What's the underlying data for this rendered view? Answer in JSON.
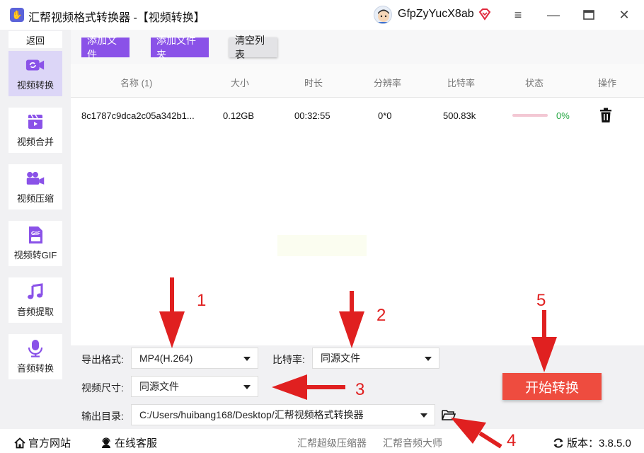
{
  "window": {
    "title": "汇帮视频格式转换器  -【视频转换】",
    "username": "GfpZyYucX8ab",
    "icons": {
      "app": "app-logo-icon",
      "avatar": "user-avatar",
      "vip": "vip-diamond-icon",
      "menu": "menu-icon",
      "minimize": "minimize-icon",
      "maximize": "maximize-icon",
      "close": "close-icon"
    }
  },
  "sidebar": {
    "back_label": "返回",
    "items": [
      {
        "label": "视频转换",
        "icon": "video-convert-icon",
        "active": true
      },
      {
        "label": "视频合并",
        "icon": "video-merge-icon",
        "active": false
      },
      {
        "label": "视频压缩",
        "icon": "video-compress-icon",
        "active": false
      },
      {
        "label": "视频转GIF",
        "icon": "gif-icon",
        "active": false
      },
      {
        "label": "音频提取",
        "icon": "music-note-icon",
        "active": false
      },
      {
        "label": "音频转换",
        "icon": "microphone-icon",
        "active": false
      }
    ]
  },
  "toolbar": {
    "add_file": "添加文件",
    "add_folder": "添加文件夹",
    "clear_list": "清空列表"
  },
  "table": {
    "columns": [
      "名称 (1)",
      "大小",
      "时长",
      "分辨率",
      "比特率",
      "状态",
      "操作"
    ],
    "rows": [
      {
        "name": "8c1787c9dca2c05a342b1...",
        "size": "0.12GB",
        "duration": "00:32:55",
        "resolution": "0*0",
        "bitrate": "500.83k",
        "progress": 0,
        "progress_text": "0%",
        "action_icon": "trash-icon"
      }
    ]
  },
  "settings": {
    "format_label": "导出格式:",
    "format_value": "MP4(H.264)",
    "bitrate_label": "比特率:",
    "bitrate_value": "同源文件",
    "size_label": "视频尺寸:",
    "size_value": "同源文件",
    "output_label": "输出目录:",
    "output_value": "C:/Users/huibang168/Desktop/汇帮视频格式转换器",
    "start_label": "开始转换",
    "folder_icon": "folder-open-icon"
  },
  "statusbar": {
    "website": "官方网站",
    "support": "在线客服",
    "link1": "汇帮超级压缩器",
    "link2": "汇帮音频大师",
    "version": "版本：3.8.5.0",
    "icons": {
      "home": "home-icon",
      "support": "support-agent-icon",
      "refresh": "refresh-icon"
    }
  },
  "annotations": {
    "numbers": [
      "1",
      "2",
      "3",
      "4",
      "5"
    ],
    "color": "#e02020"
  },
  "colors": {
    "accent": "#8a52e8",
    "start": "#ee4c3f",
    "active_tab": "#dcd6f7",
    "success": "#27a844"
  }
}
